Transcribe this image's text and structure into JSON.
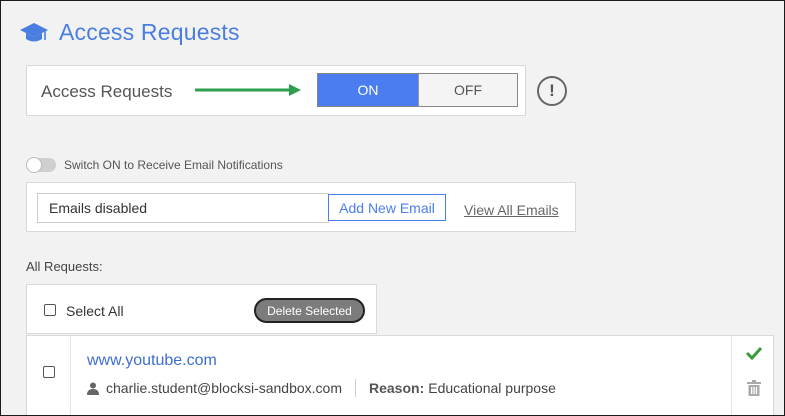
{
  "header": {
    "title": "Access Requests",
    "icon": "graduation-cap-icon"
  },
  "access_toggle": {
    "label": "Access Requests",
    "on_label": "ON",
    "off_label": "OFF",
    "selected": "ON",
    "info_icon": "exclamation-icon"
  },
  "email": {
    "switch_label": "Switch ON to Receive Email Notifications",
    "input_value": "Emails disabled",
    "add_button": "Add New Email",
    "view_all": "View All Emails"
  },
  "requests": {
    "heading": "All Requests:",
    "select_all": "Select All",
    "delete_selected": "Delete Selected",
    "items": [
      {
        "url": "www.youtube.com",
        "user": "charlie.student@blocksi-sandbox.com",
        "reason_label": "Reason:",
        "reason": "Educational purpose"
      }
    ]
  },
  "colors": {
    "accent": "#4a7df0",
    "title": "#4a7fe0",
    "arrow": "#2e9e4f",
    "approve": "#3a9a3a"
  }
}
